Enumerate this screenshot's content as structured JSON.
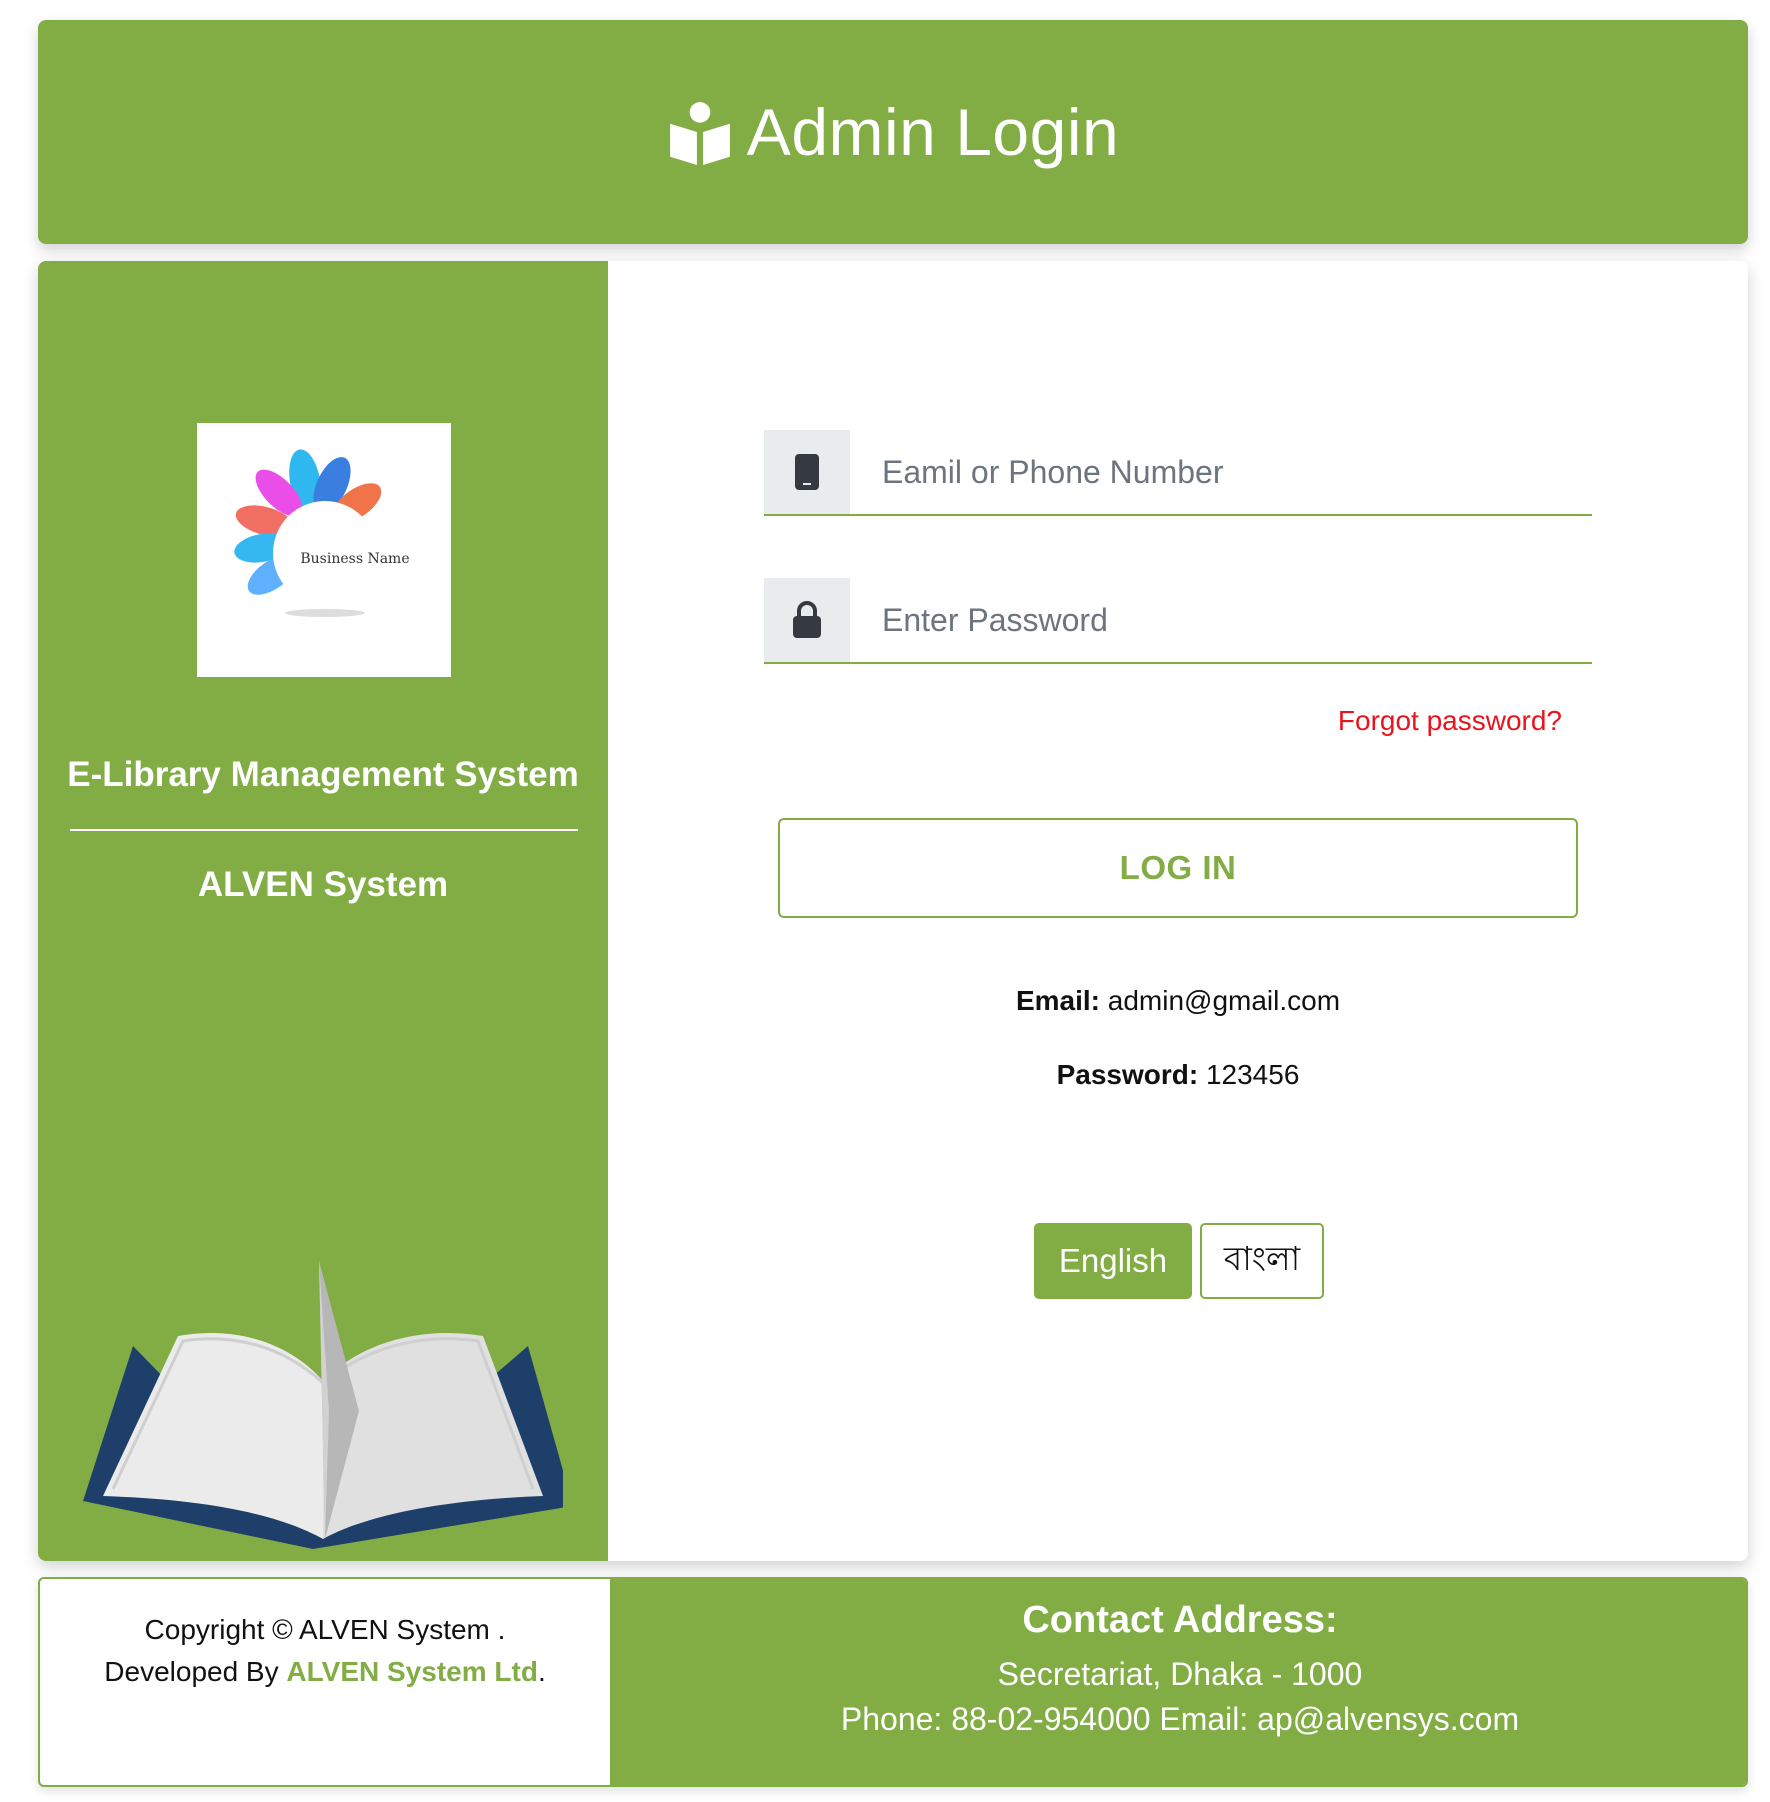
{
  "header": {
    "icon": "book-reader-icon",
    "title": "Admin Login"
  },
  "brand": {
    "logo_text": "Business Name",
    "system_name": "E-Library Management System",
    "org_name": "ALVEN System"
  },
  "login": {
    "email_placeholder": "Eamil or Phone Number",
    "email_icon": "mobile-phone-icon",
    "password_placeholder": "Enter Password",
    "password_icon": "lock-icon",
    "forgot_label": "Forgot password?",
    "submit_label": "LOG IN"
  },
  "demo_credentials": {
    "email_label": "Email:",
    "email_value": "admin@gmail.com",
    "password_label": "Password:",
    "password_value": "123456"
  },
  "language": {
    "english_label": "English",
    "bangla_label": "বাংলা"
  },
  "footer": {
    "copyright": "Copyright © ALVEN System .",
    "developed_by": "Developed By",
    "developer_name": "ALVEN System Ltd",
    "developer_suffix": ".",
    "contact_title": "Contact Address:",
    "address": "Secretariat, Dhaka - 1000",
    "phone_email": "Phone: 88-02-954000 Email: ap@alvensys.com"
  },
  "colors": {
    "brand_green": "#82ac44",
    "forgot_red": "#e8141d",
    "book_cover": "#1f3f6b"
  }
}
